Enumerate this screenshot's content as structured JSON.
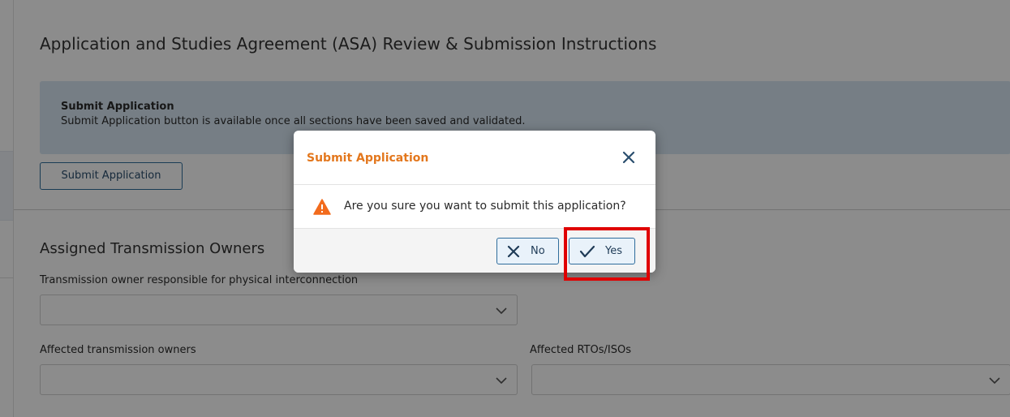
{
  "asa_section": {
    "title": "Application and Studies Agreement (ASA) Review & Submission Instructions",
    "info_title": "Submit Application",
    "info_text": "Submit Application button is available once all sections have been saved and validated.",
    "submit_button_label": "Submit Application"
  },
  "owners_section": {
    "title": "Assigned Transmission Owners",
    "physical_label": "Transmission owner responsible for physical interconnection",
    "affected_owners_label": "Affected transmission owners",
    "affected_rtos_label": "Affected RTOs/ISOs"
  },
  "modal": {
    "title": "Submit Application",
    "message": "Are you sure you want to submit this application?",
    "no_label": "No",
    "yes_label": "Yes",
    "title_color": "#e3771d",
    "warning_color": "#f26b1d"
  },
  "icons": [
    "close-icon",
    "warning-icon",
    "x-icon",
    "check-icon",
    "chevron-down-icon"
  ]
}
